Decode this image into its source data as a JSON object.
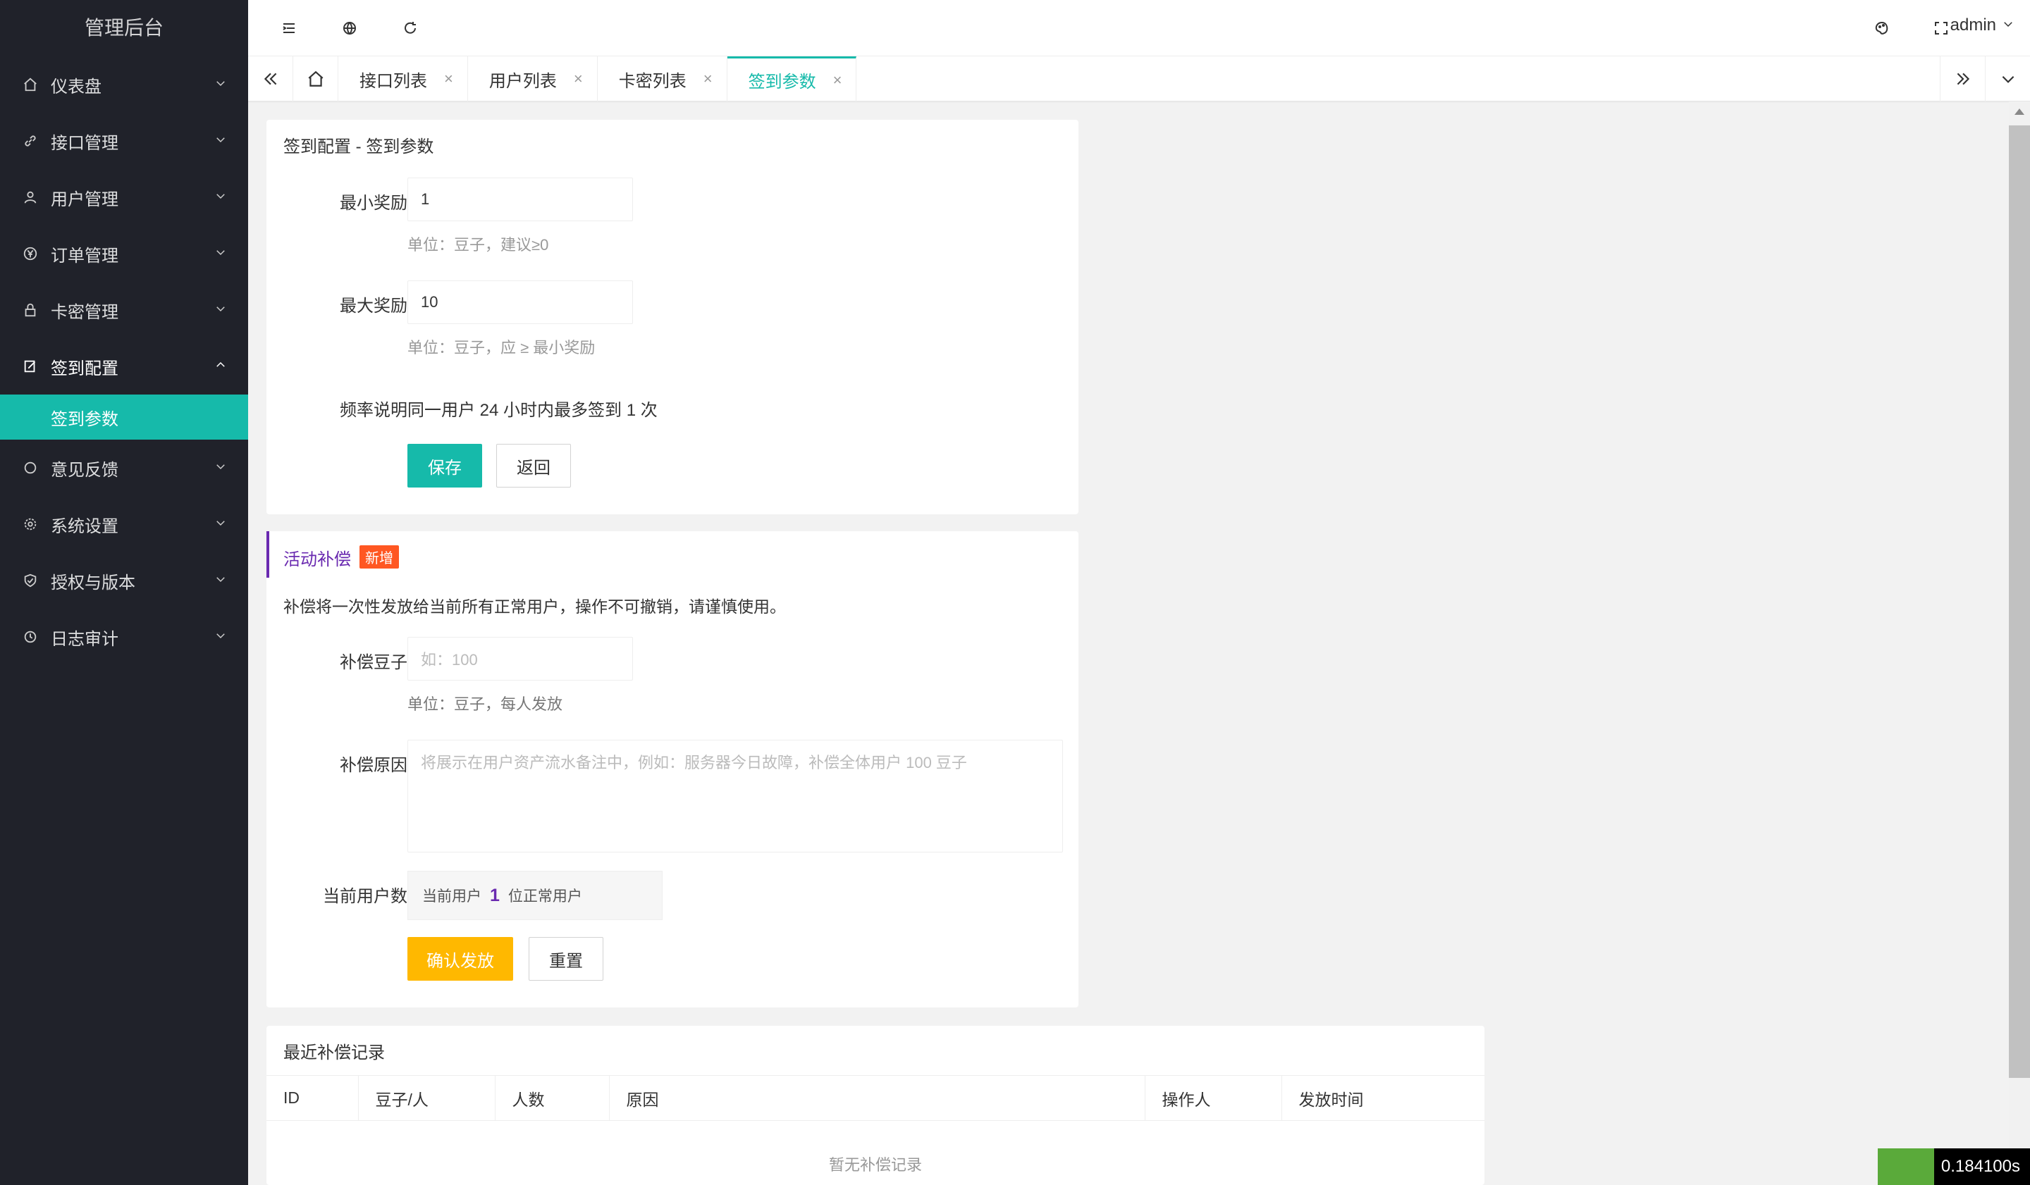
{
  "sidebar": {
    "brand": "管理后台",
    "items": [
      {
        "label": "仪表盘",
        "icon": "home-icon"
      },
      {
        "label": "接口管理",
        "icon": "link-icon"
      },
      {
        "label": "用户管理",
        "icon": "user-icon"
      },
      {
        "label": "订单管理",
        "icon": "yen-icon"
      },
      {
        "label": "卡密管理",
        "icon": "lock-icon"
      },
      {
        "label": "签到配置",
        "icon": "edit-icon",
        "open": true,
        "children": [
          "签到参数"
        ]
      },
      {
        "label": "意见反馈",
        "icon": "circle-icon"
      },
      {
        "label": "系统设置",
        "icon": "gear-icon"
      },
      {
        "label": "授权与版本",
        "icon": "shield-icon"
      },
      {
        "label": "日志审计",
        "icon": "clock-icon"
      }
    ]
  },
  "header": {
    "user": "admin"
  },
  "tabs": [
    {
      "label": "接口列表"
    },
    {
      "label": "用户列表"
    },
    {
      "label": "卡密列表"
    },
    {
      "label": "签到参数",
      "active": true
    }
  ],
  "signin_config": {
    "title": "签到配置 - 签到参数",
    "min_reward_label": "最小奖励",
    "min_reward_value": "1",
    "min_reward_hint": "单位：豆子，建议≥0",
    "max_reward_label": "最大奖励",
    "max_reward_value": "10",
    "max_reward_hint": "单位：豆子，应 ≥ 最小奖励",
    "frequency_label": "频率说明",
    "frequency_text": "同一用户 24 小时内最多签到 1 次",
    "save_label": "保存",
    "back_label": "返回"
  },
  "compensation": {
    "title": "活动补偿",
    "badge": "新增",
    "notice": "补偿将一次性发放给当前所有正常用户，操作不可撤销，请谨慎使用。",
    "beans_label": "补偿豆子",
    "beans_placeholder": "如：100",
    "beans_hint": "单位：豆子，每人发放",
    "reason_label": "补偿原因",
    "reason_placeholder": "将展示在用户资产流水备注中，例如：服务器今日故障，补偿全体用户 100 豆子",
    "users_label": "当前用户数",
    "users_prefix": "当前用户",
    "users_count": "1",
    "users_suffix": "位正常用户",
    "confirm_label": "确认发放",
    "reset_label": "重置"
  },
  "records": {
    "title": "最近补偿记录",
    "columns": [
      "ID",
      "豆子/人",
      "人数",
      "原因",
      "操作人",
      "发放时间"
    ],
    "empty": "暂无补偿记录"
  },
  "timer": "0.184100s",
  "colors": {
    "accent": "#16baaa",
    "sidebar": "#20222a",
    "warm": "#ffb800",
    "badge": "#ff5722",
    "purple": "#6a2ab0"
  }
}
